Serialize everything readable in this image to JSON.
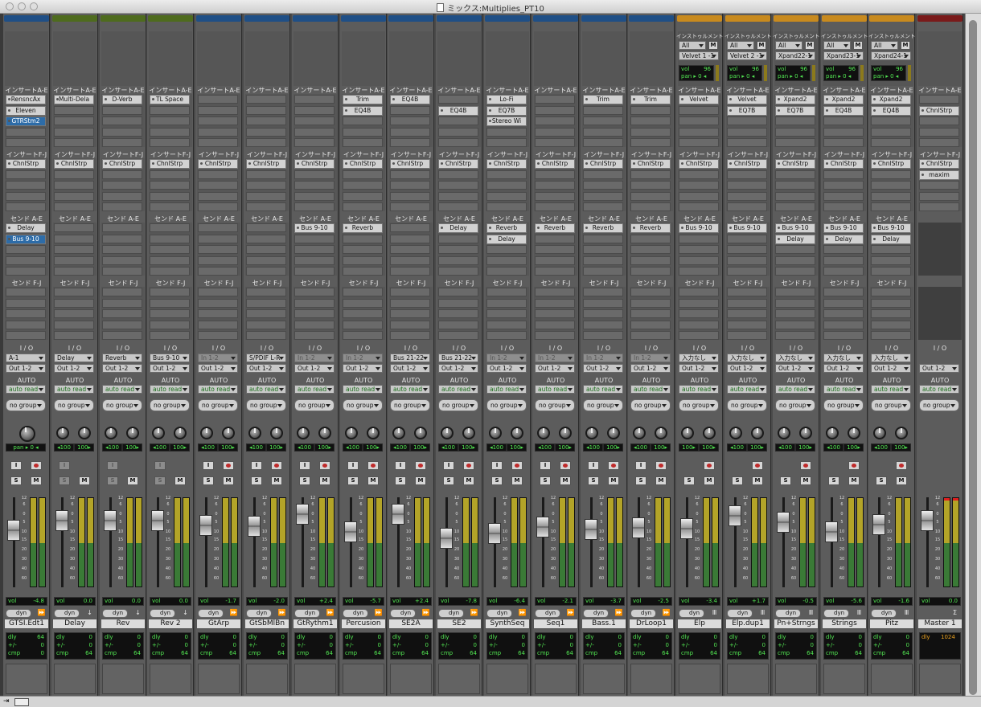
{
  "window": {
    "title": "ミックス:Multiplies_PT10"
  },
  "labels": {
    "insert_ae": "インサートA-E",
    "insert_fj": "インサートF-J",
    "send_ae": "センド A-E",
    "send_fj": "センド F-J",
    "io": "I / O",
    "auto": "AUTO",
    "instrument": "インストゥルメント",
    "all": "All",
    "m": "M",
    "vol": "vol",
    "pan": "pan",
    "dyn": "dyn",
    "dly": "dly",
    "pm": "+/-",
    "cmp": "cmp",
    "S": "S",
    "M": "M",
    "I": "I",
    "scale": [
      "12",
      "6",
      "0",
      "5",
      "10",
      "15",
      "20",
      "30",
      "40",
      "60"
    ]
  },
  "strips": [
    {
      "name": "GTSI.Edt1",
      "color": "#1f4f86",
      "inserts_ae": [
        "RensncAx",
        "Eleven",
        "GTRStm2"
      ],
      "inserts_fj": [
        "ChnlStrp"
      ],
      "sends_ae": [
        "Delay",
        "Bus 9-10"
      ],
      "io_in": "A-1",
      "io_out": "Out 1-2",
      "auto": "auto read",
      "group": "no group",
      "pan": "pan ▸ 0 ◂",
      "mono": true,
      "vol": "-4.8",
      "dly": "64",
      "pm": "0",
      "cmp": "0"
    },
    {
      "name": "Delay",
      "color": "#4e6b1e",
      "inserts_ae": [
        "Multi-Dela"
      ],
      "inserts_fj": [
        "ChnlStrp"
      ],
      "sends_ae": [],
      "io_in": "Delay",
      "io_out": "Out 1-2",
      "auto": "auto read",
      "group": "no group",
      "pan_l": "◂100",
      "pan_r": "100▸",
      "vol": "0.0",
      "dly": "0",
      "pm": "0",
      "cmp": "64",
      "aux": true
    },
    {
      "name": "Rev",
      "color": "#4e6b1e",
      "inserts_ae": [
        "D-Verb"
      ],
      "inserts_fj": [
        "ChnlStrp"
      ],
      "sends_ae": [],
      "io_in": "Reverb",
      "io_out": "Out 1-2",
      "auto": "auto read",
      "group": "no group",
      "pan_l": "◂100",
      "pan_r": "100▸",
      "vol": "0.0",
      "dly": "0",
      "pm": "0",
      "cmp": "64",
      "aux": true
    },
    {
      "name": "Rev 2",
      "color": "#4e6b1e",
      "inserts_ae": [
        "TL Space"
      ],
      "inserts_fj": [
        "ChnlStrp"
      ],
      "sends_ae": [],
      "io_in": "Bus 9-10",
      "io_out": "Out 1-2",
      "auto": "auto read",
      "group": "no group",
      "pan_l": "◂100",
      "pan_r": "100▸",
      "vol": "0.0",
      "dly": "0",
      "pm": "0",
      "cmp": "64",
      "aux": true
    },
    {
      "name": "GtArp",
      "color": "#1f4f86",
      "inserts_ae": [],
      "inserts_fj": [
        "ChnlStrp"
      ],
      "sends_ae": [],
      "io_in": "In 1-2",
      "io_in_dim": true,
      "io_out": "Out 1-2",
      "auto": "auto read",
      "group": "no group",
      "pan_l": "◂100",
      "pan_r": "100▸",
      "vol": "-1.7",
      "dly": "0",
      "pm": "0",
      "cmp": "64"
    },
    {
      "name": "GtSbMlBn",
      "color": "#1f4f86",
      "inserts_ae": [],
      "inserts_fj": [
        "ChnlStrp"
      ],
      "sends_ae": [],
      "io_in": "S/PDIF L-R",
      "io_out": "Out 1-2",
      "auto": "auto read",
      "group": "no group",
      "pan_l": "◂100",
      "pan_r": "100▸",
      "vol": "-2.0",
      "dly": "0",
      "pm": "0",
      "cmp": "64"
    },
    {
      "name": "GtRythm1",
      "color": "#1f4f86",
      "inserts_ae": [],
      "inserts_fj": [
        "ChnlStrp"
      ],
      "sends_ae": [
        "Bus 9-10"
      ],
      "io_in": "In 1-2",
      "io_in_dim": true,
      "io_out": "Out 1-2",
      "auto": "auto read",
      "group": "no group",
      "pan_l": "◂100",
      "pan_r": "100▸",
      "vol": "+2.4",
      "dly": "0",
      "pm": "0",
      "cmp": "64"
    },
    {
      "name": "Percusion",
      "color": "#1f4f86",
      "inserts_ae": [
        "Trim",
        "EQ4B"
      ],
      "inserts_fj": [
        "ChnlStrp"
      ],
      "sends_ae": [
        "Reverb"
      ],
      "io_in": "In 1-2",
      "io_in_dim": true,
      "io_out": "Out 1-2",
      "auto": "auto read",
      "group": "no group",
      "pan_l": "◂100",
      "pan_r": "100▸",
      "vol": "-5.7",
      "dly": "0",
      "pm": "0",
      "cmp": "64"
    },
    {
      "name": "SE2A",
      "color": "#1f4f86",
      "inserts_ae": [
        "EQ4B"
      ],
      "inserts_fj": [
        "ChnlStrp"
      ],
      "sends_ae": [],
      "io_in": "Bus 21-22",
      "io_out": "Out 1-2",
      "auto": "auto read",
      "group": "no group",
      "pan_l": "◂100",
      "pan_r": "100▸",
      "vol": "+2.4",
      "dly": "0",
      "pm": "0",
      "cmp": "64"
    },
    {
      "name": "SE2",
      "color": "#1f4f86",
      "inserts_ae": [
        "",
        "EQ4B"
      ],
      "inserts_fj": [
        "ChnlStrp"
      ],
      "sends_ae": [
        "Delay"
      ],
      "io_in": "Bus 21-22",
      "io_out": "Out 1-2",
      "auto": "auto read",
      "group": "no group",
      "pan_l": "◂100",
      "pan_r": "100▸",
      "vol": "-7.8",
      "dly": "0",
      "pm": "0",
      "cmp": "64"
    },
    {
      "name": "SynthSeq",
      "color": "#1f4f86",
      "inserts_ae": [
        "Lo-Fi",
        "EQ7B",
        "Stereo Wi"
      ],
      "inserts_fj": [
        "ChnlStrp"
      ],
      "sends_ae": [
        "Reverb",
        "Delay"
      ],
      "io_in": "In 1-2",
      "io_in_dim": true,
      "io_out": "Out 1-2",
      "auto": "auto read",
      "group": "no group",
      "pan_l": "◂100",
      "pan_r": "100▸",
      "vol": "-6.4",
      "dly": "0",
      "pm": "0",
      "cmp": "64"
    },
    {
      "name": "Seq1",
      "color": "#1f4f86",
      "inserts_ae": [],
      "inserts_fj": [
        "ChnlStrp"
      ],
      "sends_ae": [
        "Reverb"
      ],
      "io_in": "In 1-2",
      "io_in_dim": true,
      "io_out": "Out 1-2",
      "auto": "auto read",
      "group": "no group",
      "pan_l": "◂100",
      "pan_r": "100▸",
      "vol": "-2.1",
      "dly": "0",
      "pm": "0",
      "cmp": "64"
    },
    {
      "name": "Bass.1",
      "color": "#1f4f86",
      "inserts_ae": [
        "Trim"
      ],
      "inserts_fj": [
        "ChnlStrp"
      ],
      "sends_ae": [
        "Reverb"
      ],
      "io_in": "In 1-2",
      "io_in_dim": true,
      "io_out": "Out 1-2",
      "auto": "auto read",
      "group": "no group",
      "pan_l": "◂100",
      "pan_r": "100▸",
      "vol": "-3.7",
      "dly": "0",
      "pm": "0",
      "cmp": "64"
    },
    {
      "name": "DrLoop1",
      "color": "#1f4f86",
      "inserts_ae": [
        "Trim"
      ],
      "inserts_fj": [
        "ChnlStrp"
      ],
      "sends_ae": [
        "Reverb"
      ],
      "io_in": "In 1-2",
      "io_in_dim": true,
      "io_out": "Out 1-2",
      "auto": "auto read",
      "group": "no group",
      "pan_l": "◂100",
      "pan_r": "100▸",
      "vol": "-2.5",
      "dly": "0",
      "pm": "0",
      "cmp": "64"
    },
    {
      "name": "Elp",
      "color": "#c88a1e",
      "inst": "Velvet 1 -1",
      "inst_vol": "96",
      "inst_pan": "pan ▸ 0 ◂",
      "inserts_ae": [
        "Velvet"
      ],
      "inserts_fj": [
        "ChnlStrp"
      ],
      "sends_ae": [
        "Bus 9-10"
      ],
      "io_in": "入力なし",
      "io_out": "Out 1-2",
      "auto": "auto read",
      "group": "no group",
      "pan_l": "100▸",
      "pan_r": "100▸",
      "vol": "-3.4",
      "dly": "0",
      "pm": "0",
      "cmp": "64",
      "instr": true
    },
    {
      "name": "Elp.dup1",
      "color": "#c88a1e",
      "inst": "Velvet 2 -1",
      "inst_vol": "96",
      "inst_pan": "pan ▸ 0 ◂",
      "inserts_ae": [
        "Velvet",
        "EQ7B"
      ],
      "inserts_fj": [
        "ChnlStrp"
      ],
      "sends_ae": [
        "Bus 9-10"
      ],
      "io_in": "入力なし",
      "io_out": "Out 1-2",
      "auto": "auto read",
      "group": "no group",
      "pan_l": "◂100",
      "pan_r": "100▸",
      "vol": "+1.7",
      "dly": "0",
      "pm": "0",
      "cmp": "64",
      "instr": true
    },
    {
      "name": "Pn+Strngs",
      "color": "#c88a1e",
      "inst": "Xpand22-1",
      "inst_vol": "96",
      "inst_pan": "pan ▸ 0 ◂",
      "inserts_ae": [
        "Xpand2",
        "EQ7B"
      ],
      "inserts_fj": [
        "ChnlStrp"
      ],
      "sends_ae": [
        "Bus 9-10",
        "Delay"
      ],
      "io_in": "入力なし",
      "io_out": "Out 1-2",
      "auto": "auto read",
      "group": "no group",
      "pan_l": "◂100",
      "pan_r": "100▸",
      "vol": "-0.5",
      "dly": "0",
      "pm": "0",
      "cmp": "64",
      "instr": true
    },
    {
      "name": "Strings",
      "color": "#c88a1e",
      "inst": "Xpand23-1",
      "inst_vol": "96",
      "inst_pan": "pan ▸ 0 ◂",
      "inserts_ae": [
        "Xpand2",
        "EQ4B"
      ],
      "inserts_fj": [
        "ChnlStrp"
      ],
      "sends_ae": [
        "Bus 9-10",
        "Delay"
      ],
      "io_in": "入力なし",
      "io_out": "Out 1-2",
      "auto": "auto read",
      "group": "no group",
      "pan_l": "◂100",
      "pan_r": "100▸",
      "vol": "-5.6",
      "dly": "0",
      "pm": "0",
      "cmp": "64",
      "instr": true
    },
    {
      "name": "Pitz",
      "color": "#c88a1e",
      "inst": "Xpand24-1",
      "inst_vol": "96",
      "inst_pan": "pan ▸ 0 ◂",
      "inserts_ae": [
        "Xpand2",
        "EQ4B"
      ],
      "inserts_fj": [
        "ChnlStrp"
      ],
      "sends_ae": [
        "Bus 9-10",
        "Delay"
      ],
      "io_in": "入力なし",
      "io_out": "Out 1-2",
      "auto": "auto read",
      "group": "no group",
      "pan_l": "◂100",
      "pan_r": "100▸",
      "vol": "-1.6",
      "dly": "0",
      "pm": "0",
      "cmp": "64",
      "instr": true
    },
    {
      "name": "Master 1",
      "color": "#7a1a1a",
      "inserts_ae": [
        "",
        "ChnlStrp"
      ],
      "inserts_fj": [
        "ChnlStrp",
        "maxim"
      ],
      "sends_ae": [],
      "io_out": "Out 1-2",
      "auto": "auto read",
      "group": "no group",
      "vol": "0.0",
      "master_dly": "1024",
      "master": true
    }
  ]
}
